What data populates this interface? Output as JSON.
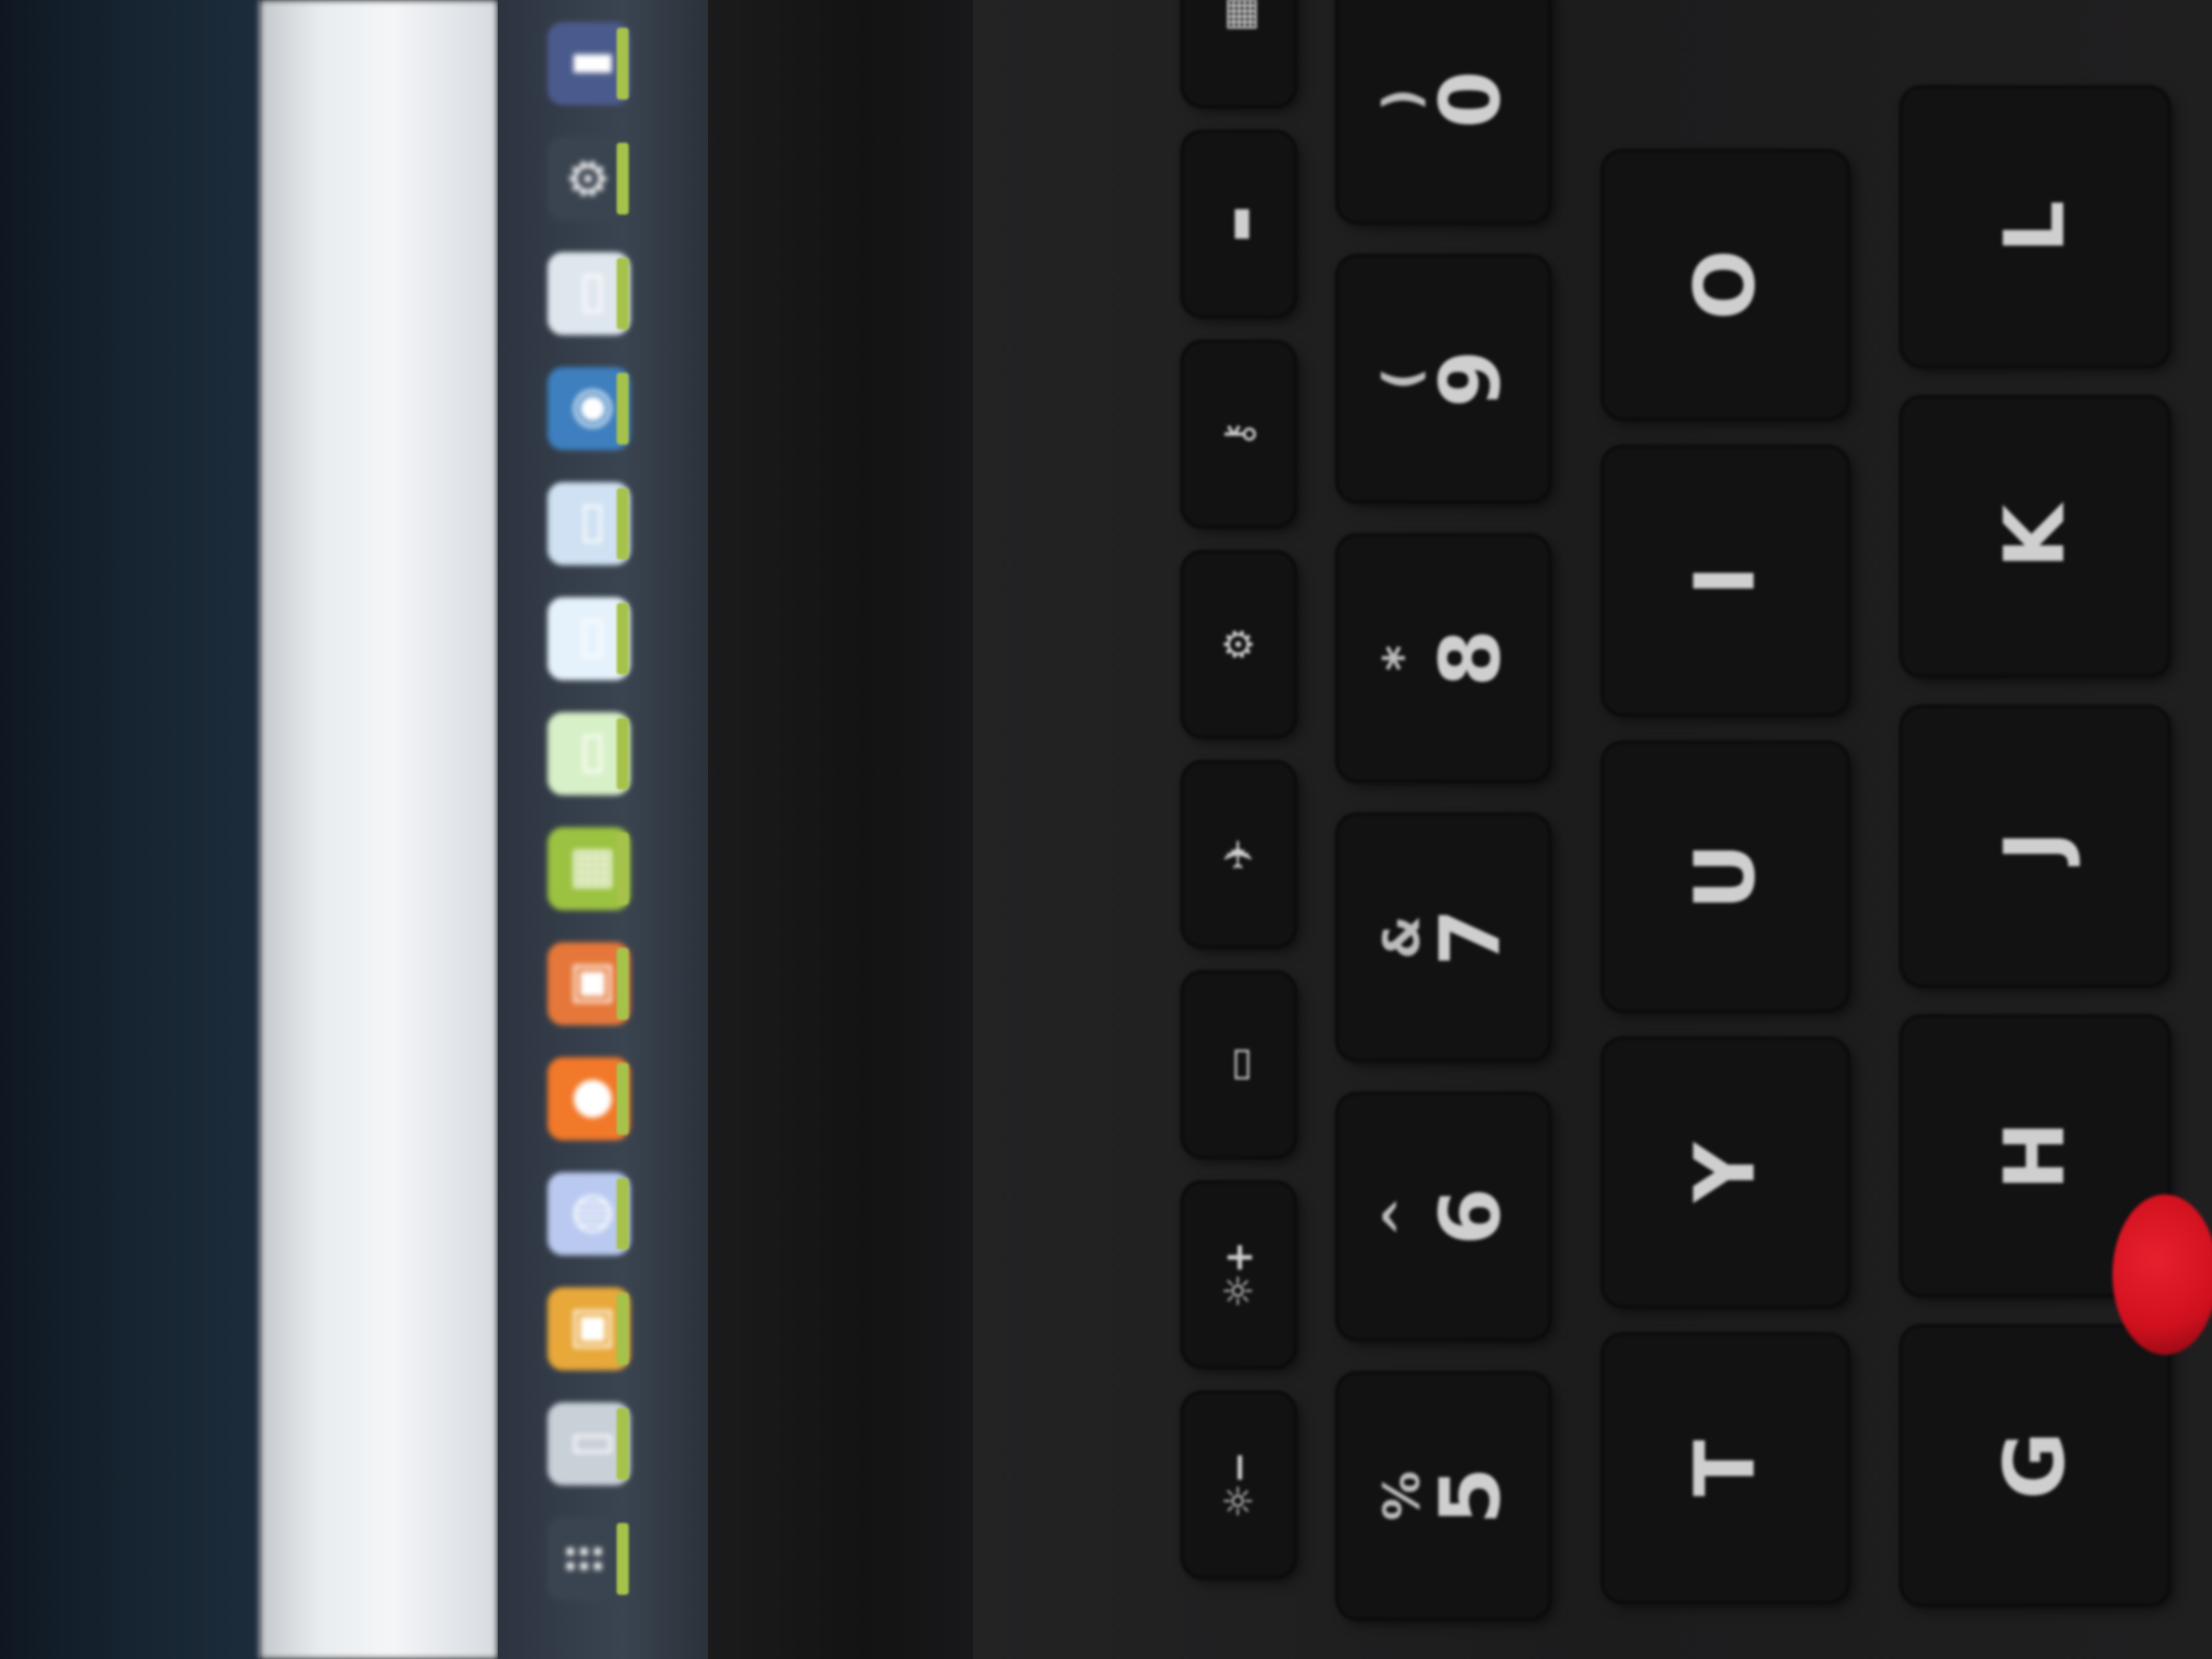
{
  "scene": {
    "description_tag": "laptop-screen-and-keyboard-photo",
    "colors": {
      "dock_indicator": "#a6c24a",
      "trackpoint": "#d0101e",
      "key": "#121213",
      "key_legend": "#cfcfcf"
    }
  },
  "dock": {
    "items": [
      {
        "icon": "terminal-icon",
        "color": "#4b5a8c",
        "glyph": "▮"
      },
      {
        "icon": "settings-gear-icon",
        "color": "#3a4450",
        "glyph": "⚙"
      },
      {
        "icon": "files-icon",
        "color": "#dfe7ee",
        "glyph": "▭"
      },
      {
        "icon": "browser-globe-icon",
        "color": "#3d7fbf",
        "glyph": "◉"
      },
      {
        "icon": "document-icon",
        "color": "#cfe1f2",
        "glyph": "▭"
      },
      {
        "icon": "writer-icon",
        "color": "#e6f2fb",
        "glyph": "▭"
      },
      {
        "icon": "calc-icon",
        "color": "#d8f0c8",
        "glyph": "▭"
      },
      {
        "icon": "spreadsheet-icon",
        "color": "#9cc242",
        "glyph": "▦"
      },
      {
        "icon": "software-center-icon",
        "color": "#e6773a",
        "glyph": "▣"
      },
      {
        "icon": "firefox-icon",
        "color": "#f2782a",
        "glyph": "●"
      },
      {
        "icon": "messaging-icon",
        "color": "#b9c9f0",
        "glyph": "◍"
      },
      {
        "icon": "photos-icon",
        "color": "#e8a83a",
        "glyph": "▣"
      },
      {
        "icon": "trash-icon",
        "color": "#c8d0d8",
        "glyph": "▯"
      },
      {
        "icon": "app-grid-icon",
        "color": "#3a4450",
        "glyph": "⠿"
      }
    ]
  },
  "keyboard": {
    "fkeys": [
      {
        "label": "☼−",
        "icon": "brightness-down-icon"
      },
      {
        "label": "☼+",
        "icon": "brightness-up-icon"
      },
      {
        "label": "▭",
        "icon": "display-icon"
      },
      {
        "label": "✈",
        "icon": "wireless-icon"
      },
      {
        "label": "⚙",
        "icon": "settings-icon"
      },
      {
        "label": "⚷",
        "icon": "key-icon"
      },
      {
        "label": "▬",
        "icon": "keyboard-backlight-icon"
      },
      {
        "label": "▦",
        "icon": "multitask-icon"
      }
    ],
    "number_row": [
      {
        "main": "5",
        "sym": "%"
      },
      {
        "main": "6",
        "sym": "^"
      },
      {
        "main": "7",
        "sym": "&"
      },
      {
        "main": "8",
        "sym": "*"
      },
      {
        "main": "9",
        "sym": "("
      },
      {
        "main": "0",
        "sym": ")"
      }
    ],
    "top_row": [
      "T",
      "Y",
      "U",
      "I",
      "O"
    ],
    "home_row": [
      "G",
      "H",
      "J",
      "K",
      "L"
    ]
  }
}
